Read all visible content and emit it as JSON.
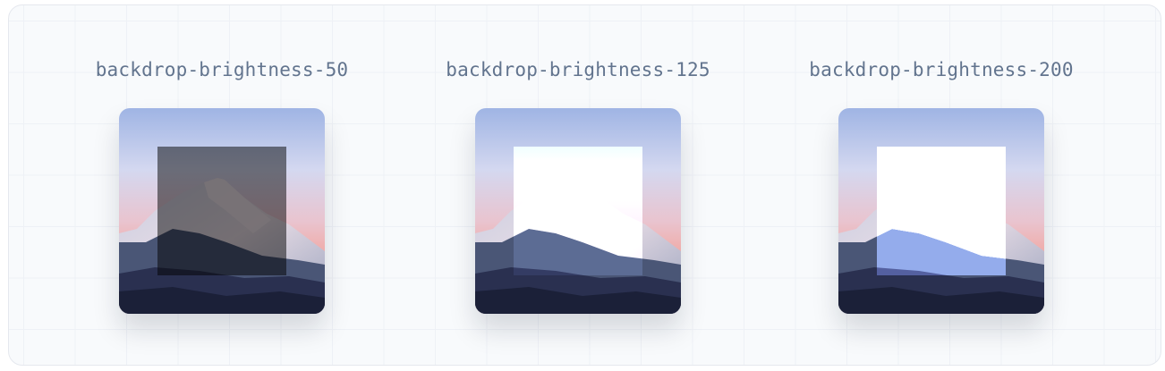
{
  "examples": [
    {
      "label": "backdrop-brightness-50",
      "brightness": 0.5
    },
    {
      "label": "backdrop-brightness-125",
      "brightness": 1.25
    },
    {
      "label": "backdrop-brightness-200",
      "brightness": 2.0
    }
  ]
}
